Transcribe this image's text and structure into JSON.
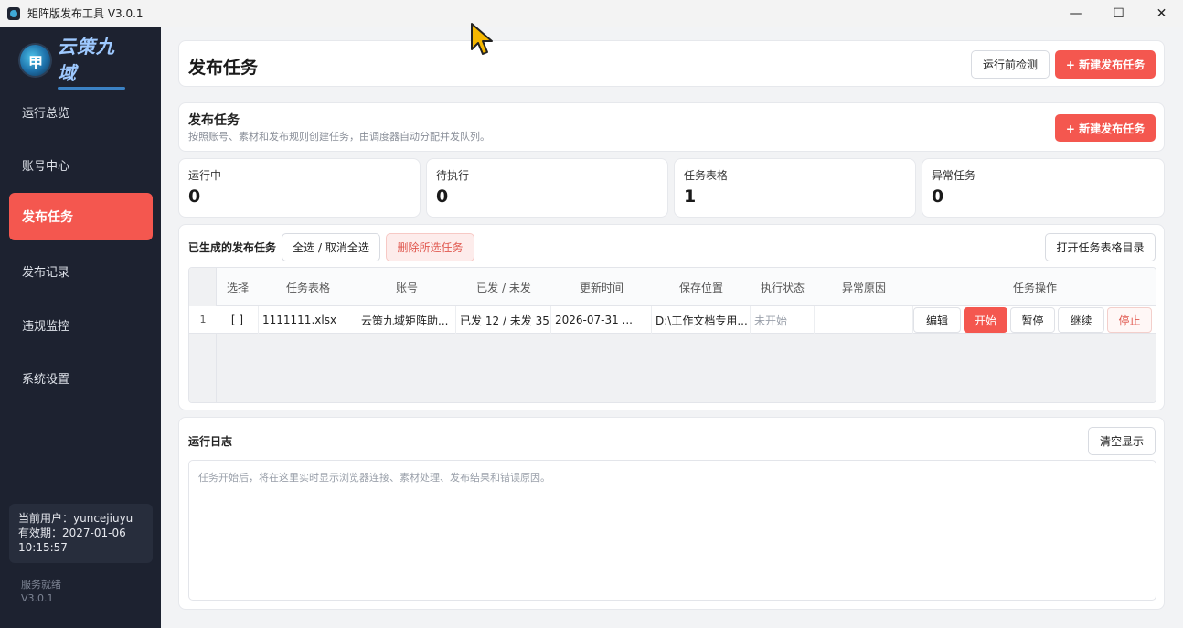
{
  "window": {
    "title": "矩阵版发布工具 V3.0.1",
    "minimize": "—",
    "maximize": "☐",
    "close": "✕"
  },
  "sidebar": {
    "logo_text": "云策九域",
    "items": [
      {
        "label": "运行总览"
      },
      {
        "label": "账号中心"
      },
      {
        "label": "发布任务",
        "active": true
      },
      {
        "label": "发布记录"
      },
      {
        "label": "违规监控"
      },
      {
        "label": "系统设置"
      }
    ],
    "user_line": "当前用户：yuncejiuyu",
    "expiry_line": "有效期：2027-01-06",
    "expiry_time": "10:15:57",
    "service_status": "服务就绪",
    "version": "V3.0.1"
  },
  "header": {
    "title": "发布任务",
    "precheck_button": "运行前检测",
    "new_task_button": "+ 新建发布任务"
  },
  "section": {
    "title": "发布任务",
    "description": "按照账号、素材和发布规则创建任务，由调度器自动分配并发队列。",
    "new_task_button": "+ 新建发布任务"
  },
  "stats": [
    {
      "label": "运行中",
      "value": "0"
    },
    {
      "label": "待执行",
      "value": "0"
    },
    {
      "label": "任务表格",
      "value": "1"
    },
    {
      "label": "异常任务",
      "value": "0"
    }
  ],
  "tasks": {
    "title": "已生成的发布任务",
    "select_all_button": "全选 / 取消全选",
    "delete_button": "删除所选任务",
    "open_dir_button": "打开任务表格目录",
    "columns": [
      "选择",
      "任务表格",
      "账号",
      "已发 / 未发",
      "更新时间",
      "保存位置",
      "执行状态",
      "异常原因",
      "任务操作"
    ],
    "rows": [
      {
        "index": "1",
        "checkbox": "[ ]",
        "file": "1111111.xlsx",
        "account": "云策九域矩阵助...",
        "progress": "已发 12 / 未发 35",
        "updated": "2026-07-31 ...",
        "location": "D:\\工作文档专用...",
        "status": "未开始",
        "error": "",
        "actions": {
          "edit": "编辑",
          "start": "开始",
          "pause": "暂停",
          "resume": "继续",
          "stop": "停止"
        }
      }
    ]
  },
  "log": {
    "title": "运行日志",
    "clear_button": "清空显示",
    "placeholder": "任务开始后，将在这里实时显示浏览器连接、素材处理、发布结果和错误原因。"
  },
  "colors": {
    "accent": "#f4574f",
    "sidebar_bg": "#1d2230"
  }
}
